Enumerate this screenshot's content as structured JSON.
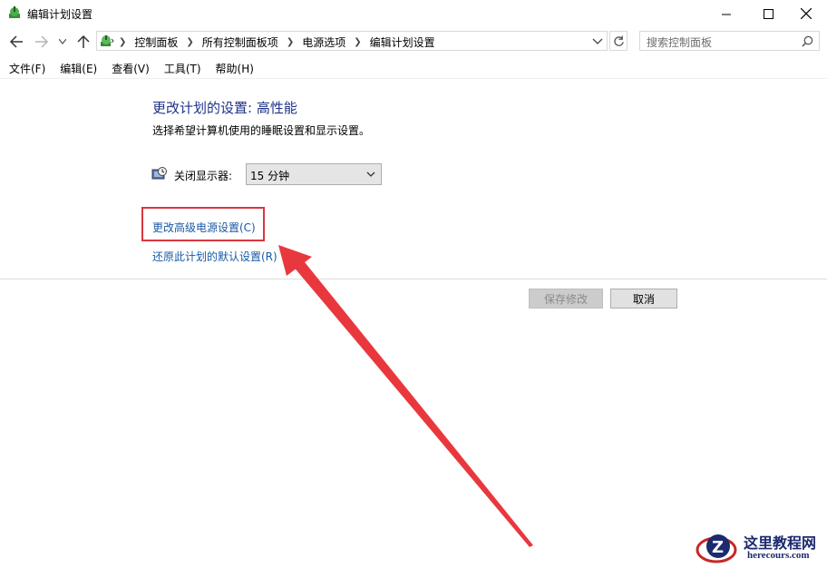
{
  "window": {
    "title": "编辑计划设置"
  },
  "address": {
    "crumbs": [
      "控制面板",
      "所有控制面板项",
      "电源选项",
      "编辑计划设置"
    ]
  },
  "search": {
    "placeholder": "搜索控制面板"
  },
  "menu": {
    "items": [
      "文件(F)",
      "编辑(E)",
      "查看(V)",
      "工具(T)",
      "帮助(H)"
    ]
  },
  "content": {
    "heading": "更改计划的设置: 高性能",
    "subtext": "选择希望计算机使用的睡眠设置和显示设置。",
    "display_label": "关闭显示器:",
    "display_value": "15 分钟",
    "advanced_link": "更改高级电源设置(C)",
    "restore_link": "还原此计划的默认设置(R)"
  },
  "buttons": {
    "save": "保存修改",
    "cancel": "取消"
  },
  "watermark": {
    "name": "这里教程网",
    "url": "herecours.com"
  },
  "colors": {
    "heading": "#1e3287",
    "link": "#1a5aa6",
    "annotation": "#d9363e"
  }
}
